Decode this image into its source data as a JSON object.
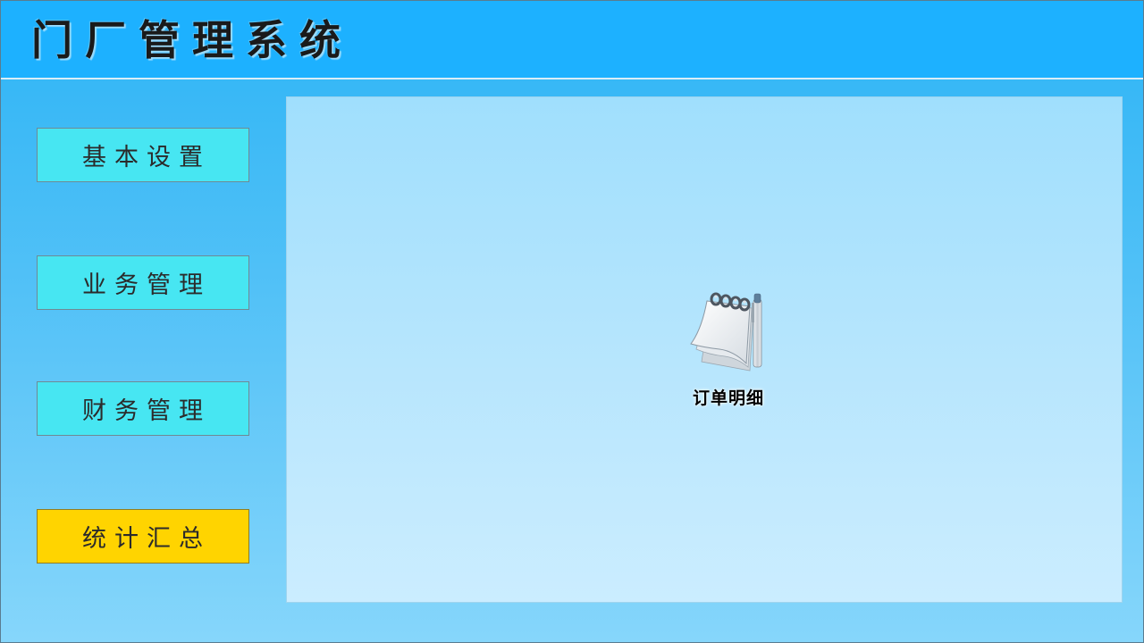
{
  "header": {
    "title": "门厂管理系统"
  },
  "sidebar": {
    "items": [
      {
        "label": "基本设置",
        "active": false
      },
      {
        "label": "业务管理",
        "active": false
      },
      {
        "label": "财务管理",
        "active": false
      },
      {
        "label": "统计汇总",
        "active": true
      }
    ]
  },
  "main": {
    "items": [
      {
        "label": "订单明细",
        "icon": "notepad-icon"
      }
    ]
  },
  "colors": {
    "header_bg": "#1db1ff",
    "nav_button": "#47e6f2",
    "nav_button_active": "#ffd400",
    "content_bg": "#b8e6fd"
  }
}
